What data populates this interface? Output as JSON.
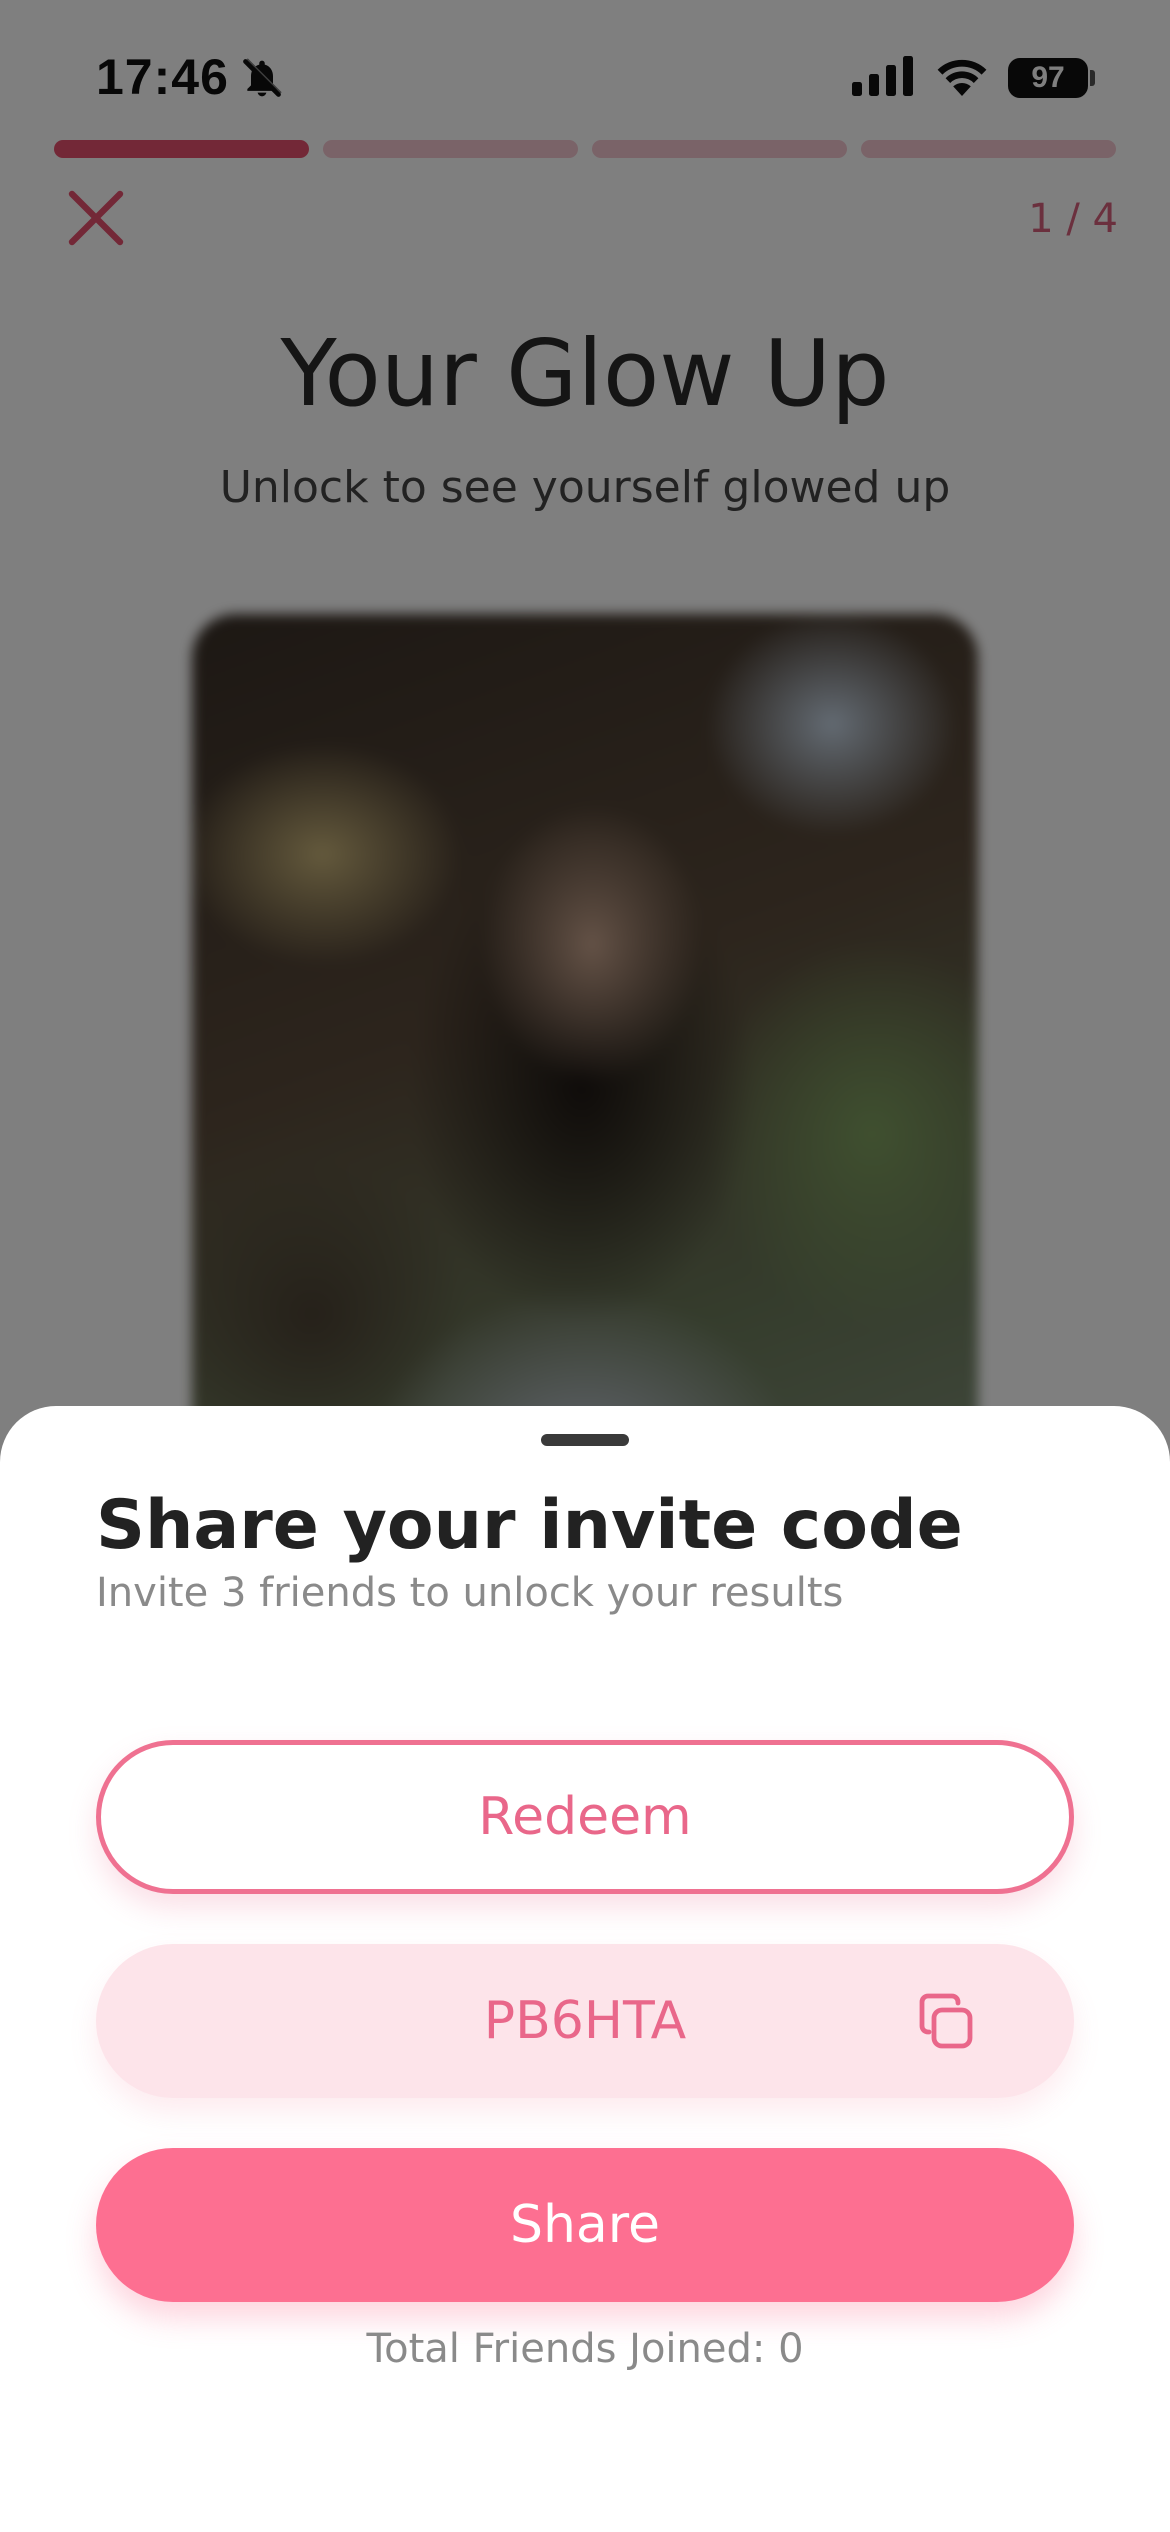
{
  "status_bar": {
    "time": "17:46",
    "battery": "97",
    "icons": [
      "bell-slash-icon",
      "cellular-signal-icon",
      "wifi-icon",
      "battery-icon"
    ]
  },
  "progress": {
    "current_step": 1,
    "total_steps": 4,
    "counter_label": "1 / 4"
  },
  "header": {
    "close_icon": "close-icon",
    "title": "Your Glow Up",
    "subtitle": "Unlock to see yourself glowed up"
  },
  "sheet": {
    "title": "Share your invite code",
    "subtitle": "Invite 3 friends to unlock your results",
    "redeem_label": "Redeem",
    "invite_code": "PB6HTA",
    "copy_icon": "copy-icon",
    "share_label": "Share",
    "friends_joined": "Total Friends Joined: 0"
  },
  "colors": {
    "accent": "#fd6f91",
    "accent_text": "#e9678a",
    "code_background": "#fde4ea",
    "progress_active": "#e6506e",
    "progress_inactive": "#f5c6d0"
  }
}
